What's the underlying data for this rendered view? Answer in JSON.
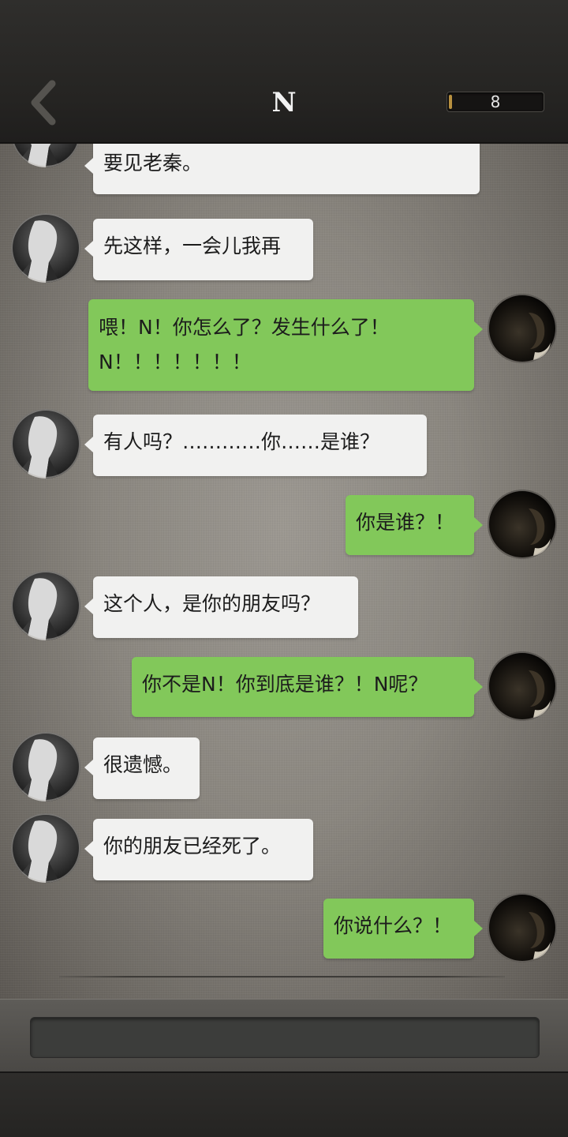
{
  "header": {
    "title": "N",
    "back_icon": "chevron-left-icon",
    "counter_value": "8"
  },
  "colors": {
    "incoming_bubble": "#f1f1f0",
    "outgoing_bubble": "#82c85a",
    "header_bg": "#252422"
  },
  "messages": [
    {
      "from": "contact",
      "text": "要见老秦。"
    },
    {
      "from": "contact",
      "text": "先这样，一会儿我再"
    },
    {
      "from": "me",
      "lines": [
        "喂！N！你怎么了？发生什么了！",
        "N！！！！！！！"
      ]
    },
    {
      "from": "contact",
      "text": "有人吗？…………你……是谁？"
    },
    {
      "from": "me",
      "text": "你是谁？！"
    },
    {
      "from": "contact",
      "text": "这个人，是你的朋友吗？"
    },
    {
      "from": "me",
      "text": "你不是N！你到底是谁？！N呢？"
    },
    {
      "from": "contact",
      "text": "很遗憾。"
    },
    {
      "from": "contact",
      "text": "你的朋友已经死了。"
    },
    {
      "from": "me",
      "text": "你说什么？！"
    }
  ],
  "input": {
    "placeholder": ""
  }
}
